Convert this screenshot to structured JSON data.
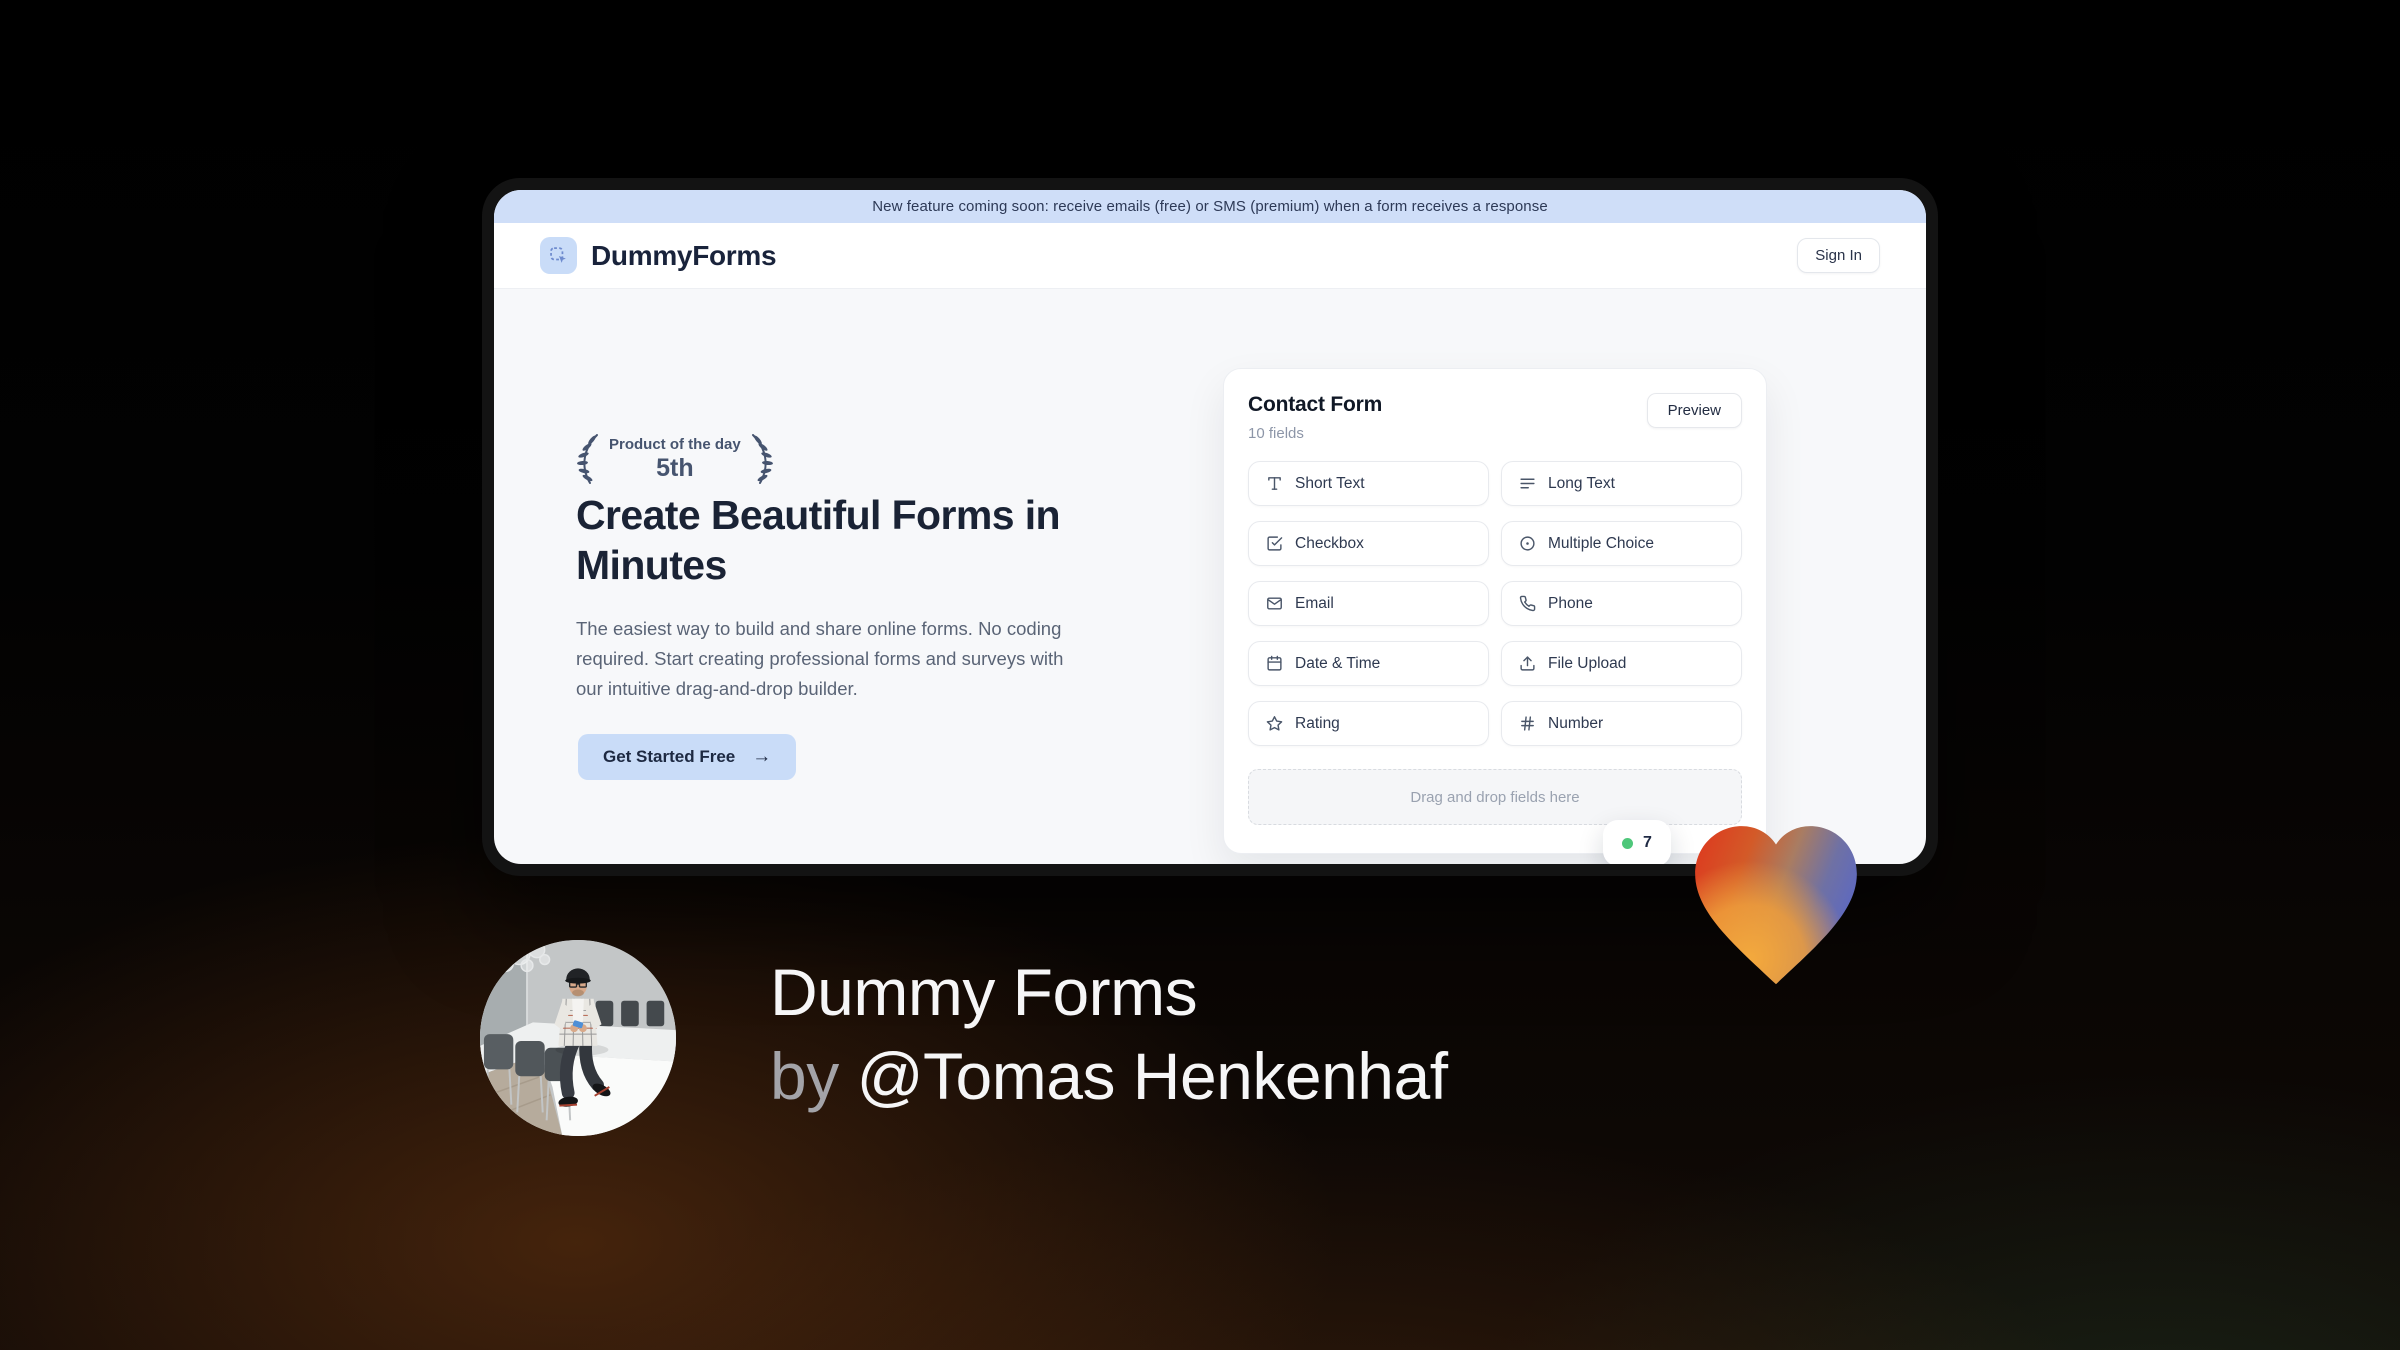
{
  "banner": {
    "text": "New feature coming soon: receive emails (free) or SMS (premium) when a form receives a response"
  },
  "nav": {
    "brand": "DummyForms",
    "sign_in_label": "Sign In"
  },
  "hero": {
    "award_title": "Product of the day",
    "award_rank": "5th",
    "heading_line1": "Create Beautiful Forms in",
    "heading_line2": "Minutes",
    "description": "The easiest way to build and share online forms. No coding required. Start creating professional forms and surveys with our intuitive drag-and-drop builder.",
    "cta_label": "Get Started Free",
    "cta_arrow": "→"
  },
  "builder": {
    "title": "Contact Form",
    "field_count": "10 fields",
    "preview_label": "Preview",
    "fields": [
      {
        "label": "Short Text",
        "icon": "type-icon"
      },
      {
        "label": "Long Text",
        "icon": "align-left-icon"
      },
      {
        "label": "Checkbox",
        "icon": "checkbox-icon"
      },
      {
        "label": "Multiple Choice",
        "icon": "radio-icon"
      },
      {
        "label": "Email",
        "icon": "mail-icon"
      },
      {
        "label": "Phone",
        "icon": "phone-icon"
      },
      {
        "label": "Date & Time",
        "icon": "calendar-icon"
      },
      {
        "label": "File Upload",
        "icon": "upload-icon"
      },
      {
        "label": "Rating",
        "icon": "star-icon"
      },
      {
        "label": "Number",
        "icon": "hash-icon"
      }
    ],
    "dropzone_hint": "Drag and drop fields here",
    "status_badge": {
      "text": "7"
    }
  },
  "caption": {
    "title": "Dummy Forms",
    "byline_prefix": "by",
    "author": "@Tomas Henkenhaf"
  },
  "colors": {
    "banner_blue": "#cfdef8",
    "accent_blue": "#c9dcf8",
    "navy_text": "#1a2335",
    "badge_green": "#4ec77a",
    "heart_red": "#dd3a1f",
    "heart_orange": "#f0a03c",
    "heart_blue": "#5c68c2"
  }
}
